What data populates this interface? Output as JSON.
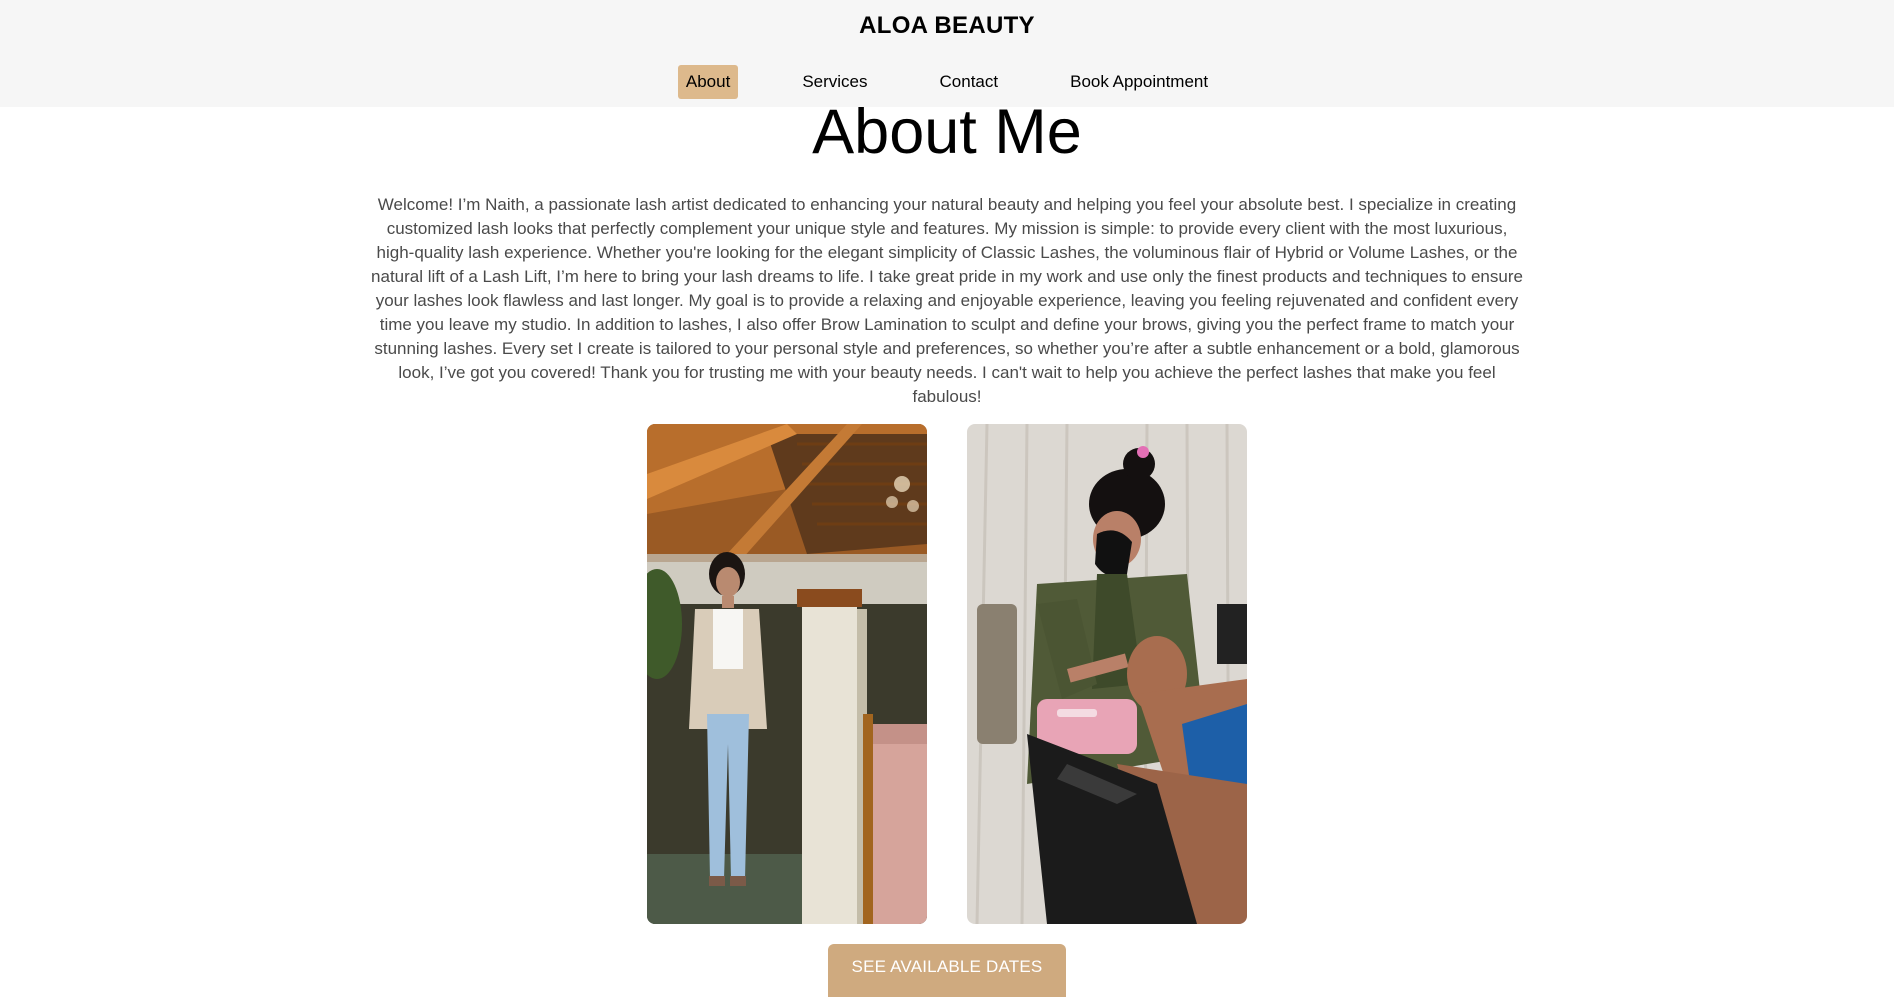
{
  "header": {
    "brand": "ALOA BEAUTY",
    "nav": [
      {
        "label": "About",
        "active": true
      },
      {
        "label": "Services",
        "active": false
      },
      {
        "label": "Contact",
        "active": false
      },
      {
        "label": "Book Appointment",
        "active": false
      }
    ]
  },
  "about": {
    "title": "About Me",
    "body": "Welcome! I’m Naith, a passionate lash artist dedicated to enhancing your natural beauty and helping you feel your absolute best. I specialize in creating customized lash looks that perfectly complement your unique style and features. My mission is simple: to provide every client with the most luxurious, high-quality lash experience. Whether you're looking for the elegant simplicity of Classic Lashes, the voluminous flair of Hybrid or Volume Lashes, or the natural lift of a Lash Lift, I’m here to bring your lash dreams to life. I take great pride in my work and use only the finest products and techniques to ensure your lashes look flawless and last longer. My goal is to provide a relaxing and enjoyable experience, leaving you feeling rejuvenated and confident every time you leave my studio. In addition to lashes, I also offer Brow Lamination to sculpt and define your brows, giving you the perfect frame to match your stunning lashes. Every set I create is tailored to your personal style and preferences, so whether you’re after a subtle enhancement or a bold, glamorous look, I’ve got you covered! Thank you for trusting me with your beauty needs. I can't wait to help you achieve the perfect lashes that make you feel fabulous!",
    "cta_label": "SEE AVAILABLE DATES"
  },
  "colors": {
    "header_bg": "#f6f6f6",
    "nav_active": "#ddb98c",
    "cta_bg": "#cfaa7f",
    "body_text": "#4a4a4a"
  }
}
